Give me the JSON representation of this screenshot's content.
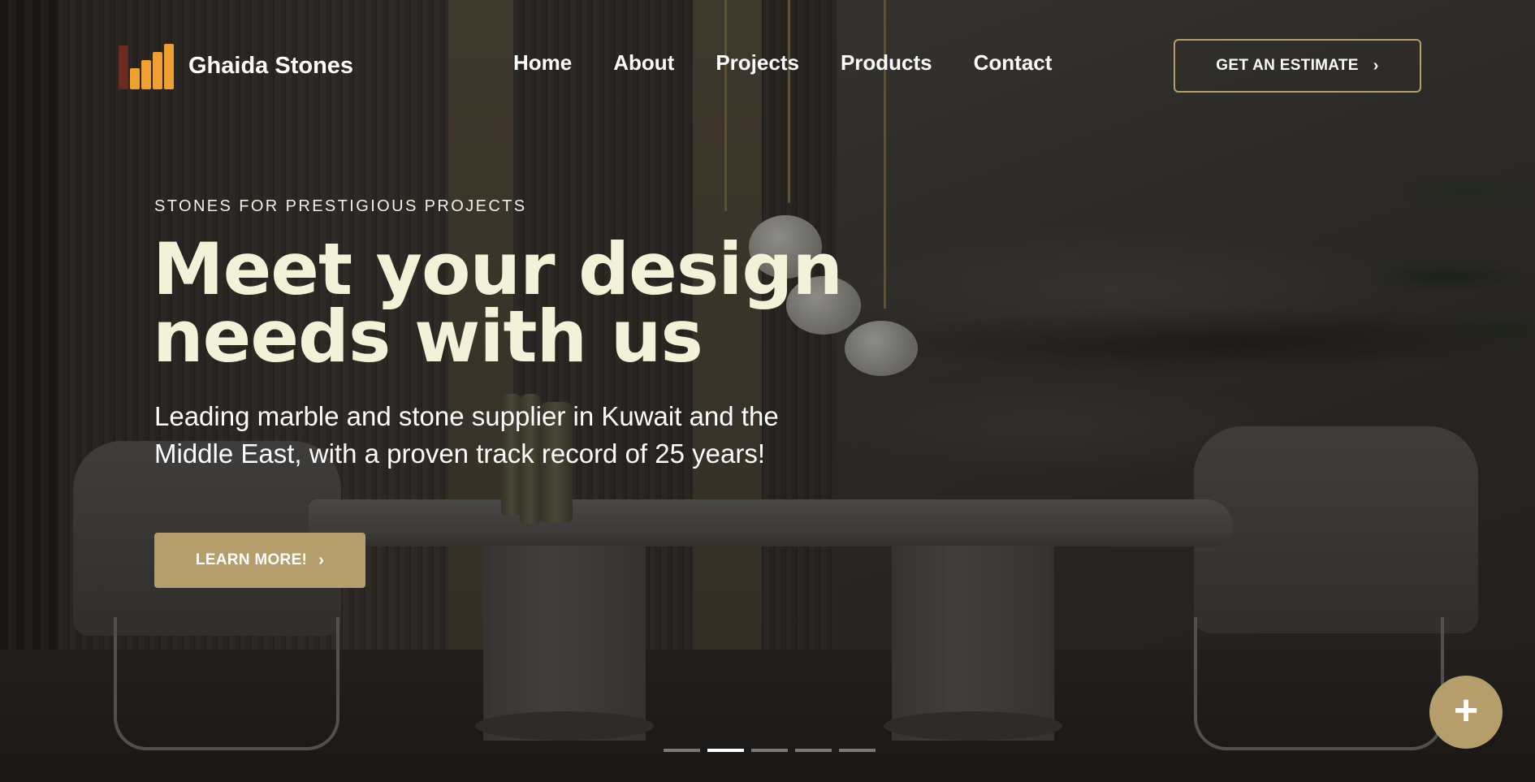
{
  "brand": {
    "name": "Ghaida Stones",
    "logo_icon": "bar-chart-logo-icon"
  },
  "nav": {
    "items": [
      {
        "label": "Home"
      },
      {
        "label": "About"
      },
      {
        "label": "Projects"
      },
      {
        "label": "Products"
      },
      {
        "label": "Contact"
      }
    ]
  },
  "header": {
    "cta_label": "GET AN ESTIMATE",
    "cta_icon": "chevron-right-icon"
  },
  "hero": {
    "eyebrow": "STONES FOR PRESTIGIOUS PROJECTS",
    "headline_line1": "Meet your design",
    "headline_line2": "needs with us",
    "subtext_line1": "Leading marble and stone supplier in Kuwait and the",
    "subtext_line2": "Middle East, with a proven track record of 25 years!",
    "button_label": "LEARN MORE!",
    "button_icon": "chevron-right-icon"
  },
  "slider": {
    "total": 5,
    "active_index": 1
  },
  "fab": {
    "icon": "plus-icon"
  },
  "colors": {
    "accent_gold": "#b69e6c",
    "headline_cream": "#f3f2d9",
    "logo_orange": "#f0a030",
    "logo_dark": "#6a2a20"
  }
}
